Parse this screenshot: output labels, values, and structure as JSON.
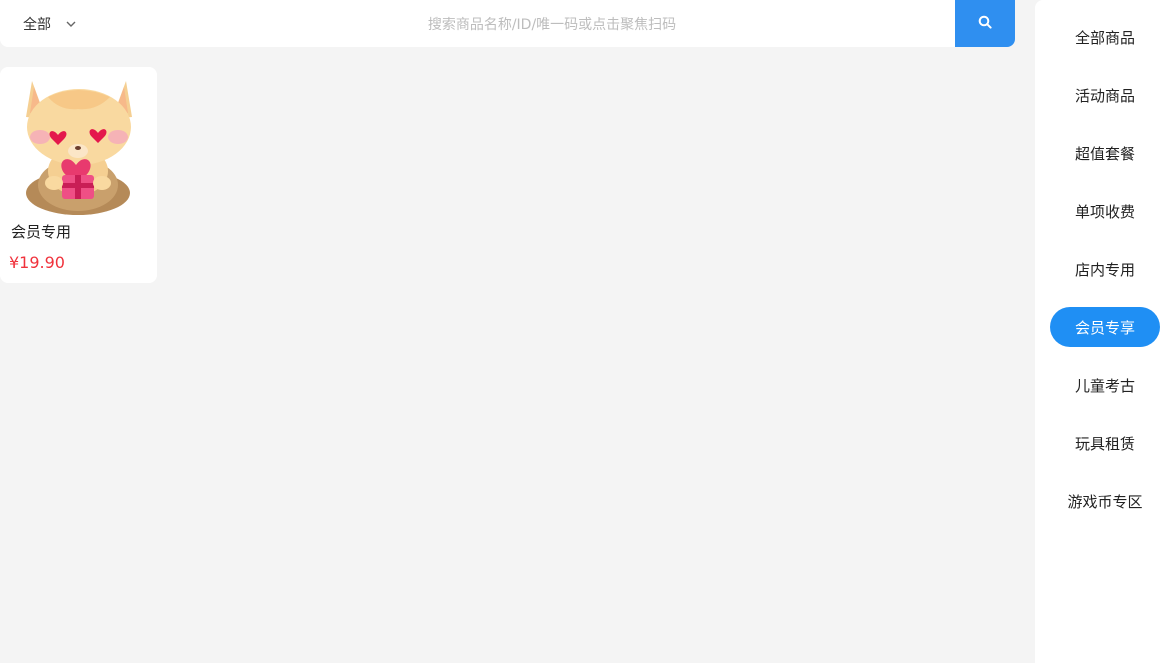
{
  "search": {
    "scope_label": "全部",
    "placeholder": "搜索商品名称/ID/唯一码或点击聚焦扫码",
    "value": ""
  },
  "products": [
    {
      "name": "会员专用",
      "price": "¥19.90"
    }
  ],
  "categories": {
    "active_index": 5,
    "items": [
      "全部商品",
      "活动商品",
      "超值套餐",
      "单项收费",
      "店内专用",
      "会员专享",
      "儿童考古",
      "玩具租赁",
      "游戏币专区"
    ]
  },
  "colors": {
    "accent": "#1f8ff4",
    "price": "#f0323c",
    "background": "#f4f4f4"
  },
  "icons": [
    "chevron-down-icon",
    "search-icon"
  ]
}
